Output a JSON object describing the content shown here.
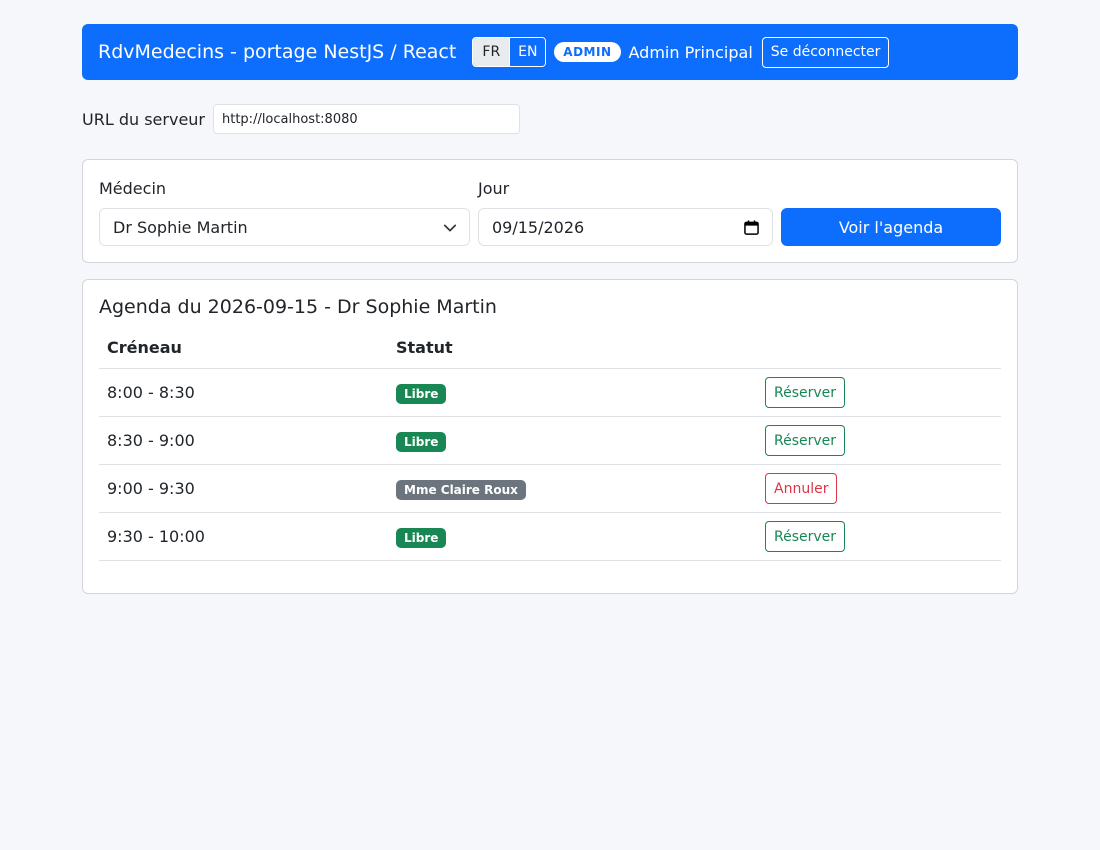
{
  "header": {
    "brand": "RdvMedecins - portage NestJS / React",
    "lang_fr": "FR",
    "lang_en": "EN",
    "role_badge": "ADMIN",
    "user_name": "Admin Principal",
    "logout_label": "Se déconnecter"
  },
  "server": {
    "label": "URL du serveur",
    "value": "http://localhost:8080"
  },
  "form": {
    "doctor_label": "Médecin",
    "doctor_value": "Dr Sophie Martin",
    "day_label": "Jour",
    "day_value": "09/15/2026",
    "submit_label": "Voir l'agenda"
  },
  "agenda": {
    "title": "Agenda du 2026-09-15 - Dr Sophie Martin",
    "col_slot": "Créneau",
    "col_status": "Statut",
    "rows": [
      {
        "slot": "8:00 - 8:30",
        "status": "Libre",
        "action": "Réserver"
      },
      {
        "slot": "8:30 - 9:00",
        "status": "Libre",
        "action": "Réserver"
      },
      {
        "slot": "9:00 - 9:30",
        "status": "Mme Claire Roux",
        "action": "Annuler"
      },
      {
        "slot": "9:30 - 10:00",
        "status": "Libre",
        "action": "Réserver"
      }
    ]
  },
  "colors": {
    "primary": "#0d6efd",
    "success": "#198754",
    "danger": "#dc3545",
    "secondary": "#6c757d"
  },
  "icons": {
    "select": "chevron-down-icon",
    "date": "calendar-icon"
  }
}
